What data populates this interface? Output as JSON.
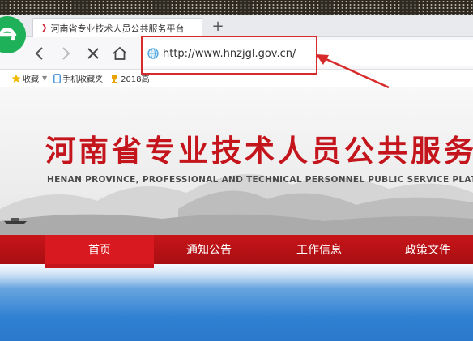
{
  "browser": {
    "tab": {
      "title": "河南省专业技术人员公共服务平台"
    },
    "address_bar": {
      "url": "http://www.hnzjgl.gov.cn/"
    },
    "bookmarks": [
      {
        "label": "收藏"
      },
      {
        "label": "手机收藏夹"
      },
      {
        "label": "2018高"
      }
    ]
  },
  "banner": {
    "title": "河南省专业技术人员公共服务平",
    "subtitle": "HENAN PROVINCE, PROFESSIONAL AND TECHNICAL PERSONNEL PUBLIC SERVICE PLATF"
  },
  "main_nav": {
    "items": [
      {
        "label": "首页"
      },
      {
        "label": "通知公告"
      },
      {
        "label": "工作信息"
      },
      {
        "label": "政策文件"
      }
    ]
  },
  "colors": {
    "brand_red": "#c4151c",
    "highlight_red": "#d72b2b",
    "browser_green": "#1fb15a"
  }
}
